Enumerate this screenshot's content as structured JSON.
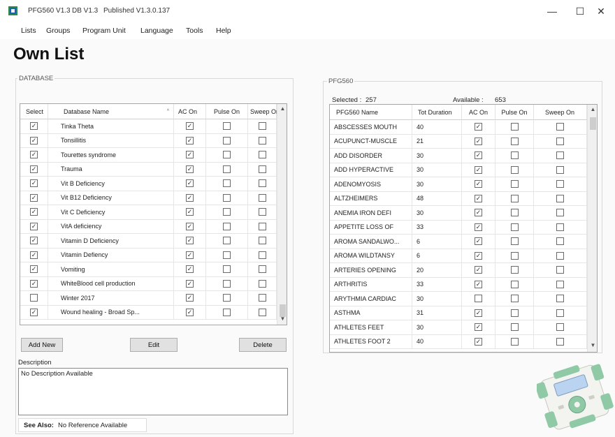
{
  "window": {
    "title_parts": [
      "PFG560 V1.3",
      "DB V1.3",
      "Published V1.3.0.137"
    ],
    "controls": [
      "—",
      "☐",
      "✕"
    ]
  },
  "menu": [
    "Lists",
    "Groups",
    "Program Unit",
    "Language",
    "Tools",
    "Help"
  ],
  "page_title": "Own List",
  "database": {
    "group_label": "DATABASE",
    "columns": [
      "Select",
      "Database Name",
      "AC On",
      "Pulse On",
      "Sweep On"
    ],
    "rows": [
      {
        "select": true,
        "name": "Tinka Theta",
        "ac": true,
        "pulse": false,
        "sweep": false
      },
      {
        "select": true,
        "name": "Tonsillitis",
        "ac": true,
        "pulse": false,
        "sweep": false
      },
      {
        "select": true,
        "name": "Tourettes syndrome",
        "ac": true,
        "pulse": false,
        "sweep": false
      },
      {
        "select": true,
        "name": "Trauma",
        "ac": true,
        "pulse": false,
        "sweep": false
      },
      {
        "select": true,
        "name": "Vit B Deficiency",
        "ac": true,
        "pulse": false,
        "sweep": false
      },
      {
        "select": true,
        "name": "Vit B12 Deficiency",
        "ac": true,
        "pulse": false,
        "sweep": false
      },
      {
        "select": true,
        "name": "Vit C Deficiency",
        "ac": true,
        "pulse": false,
        "sweep": false
      },
      {
        "select": true,
        "name": "VitA deficiency",
        "ac": true,
        "pulse": false,
        "sweep": false
      },
      {
        "select": true,
        "name": "Vitamin D Deficiency",
        "ac": true,
        "pulse": false,
        "sweep": false
      },
      {
        "select": true,
        "name": "Vitamin Defiency",
        "ac": true,
        "pulse": false,
        "sweep": false
      },
      {
        "select": true,
        "name": "Vomiting",
        "ac": true,
        "pulse": false,
        "sweep": false
      },
      {
        "select": true,
        "name": "WhiteBlood cell production",
        "ac": true,
        "pulse": false,
        "sweep": false
      },
      {
        "select": false,
        "name": "Winter 2017",
        "ac": true,
        "pulse": false,
        "sweep": false
      },
      {
        "select": true,
        "name": "Wound healing - Broad Sp...",
        "ac": true,
        "pulse": false,
        "sweep": false
      }
    ],
    "buttons": {
      "add": "Add New",
      "edit": "Edit",
      "delete": "Delete"
    },
    "description_label": "Description",
    "description_value": "No Description Available",
    "see_also_label": "See Also:",
    "see_also_value": "No Reference Available"
  },
  "pfg": {
    "group_label": "PFG560",
    "selected_label": "Selected :",
    "selected_value": "257",
    "available_label": "Available :",
    "available_value": "653",
    "columns": [
      "PFG560 Name",
      "Tot Duration",
      "AC On",
      "Pulse On",
      "Sweep On"
    ],
    "rows": [
      {
        "name": "ABSCESSES MOUTH",
        "dur": "40",
        "ac": true,
        "pulse": false,
        "sweep": false
      },
      {
        "name": "ACUPUNCT-MUSCLE",
        "dur": "21",
        "ac": true,
        "pulse": false,
        "sweep": false
      },
      {
        "name": "ADD DISORDER",
        "dur": "30",
        "ac": true,
        "pulse": false,
        "sweep": false
      },
      {
        "name": "ADD HYPERACTIVE",
        "dur": "30",
        "ac": true,
        "pulse": false,
        "sweep": false
      },
      {
        "name": "ADENOMYOSIS",
        "dur": "30",
        "ac": true,
        "pulse": false,
        "sweep": false
      },
      {
        "name": "ALTZHEIMERS",
        "dur": "48",
        "ac": true,
        "pulse": false,
        "sweep": false
      },
      {
        "name": "ANEMIA IRON DEFI",
        "dur": "30",
        "ac": true,
        "pulse": false,
        "sweep": false
      },
      {
        "name": "APPETITE LOSS OF",
        "dur": "33",
        "ac": true,
        "pulse": false,
        "sweep": false
      },
      {
        "name": "AROMA SANDALWO...",
        "dur": "6",
        "ac": true,
        "pulse": false,
        "sweep": false
      },
      {
        "name": "AROMA WILDTANSY",
        "dur": "6",
        "ac": true,
        "pulse": false,
        "sweep": false
      },
      {
        "name": "ARTERIES OPENING",
        "dur": "20",
        "ac": true,
        "pulse": false,
        "sweep": false
      },
      {
        "name": "ARTHRITIS",
        "dur": "33",
        "ac": true,
        "pulse": false,
        "sweep": false
      },
      {
        "name": "ARYTHMIA CARDIAC",
        "dur": "30",
        "ac": false,
        "pulse": false,
        "sweep": false
      },
      {
        "name": "ASTHMA",
        "dur": "31",
        "ac": true,
        "pulse": false,
        "sweep": false
      },
      {
        "name": "ATHLETES FEET",
        "dur": "30",
        "ac": true,
        "pulse": false,
        "sweep": false
      },
      {
        "name": "ATHLETES FOOT 2",
        "dur": "40",
        "ac": true,
        "pulse": false,
        "sweep": false
      }
    ]
  },
  "icons": {
    "app": "app-icon",
    "sort": "sort-ascending-icon",
    "scroll_up": "scroll-up-arrow-icon",
    "scroll_down": "scroll-down-arrow-icon",
    "device": "device-illustration-icon"
  },
  "colors": {
    "device_body": "#8fc9a5",
    "device_screen": "#b9d3f0",
    "device_panel": "#f3f3f0"
  }
}
